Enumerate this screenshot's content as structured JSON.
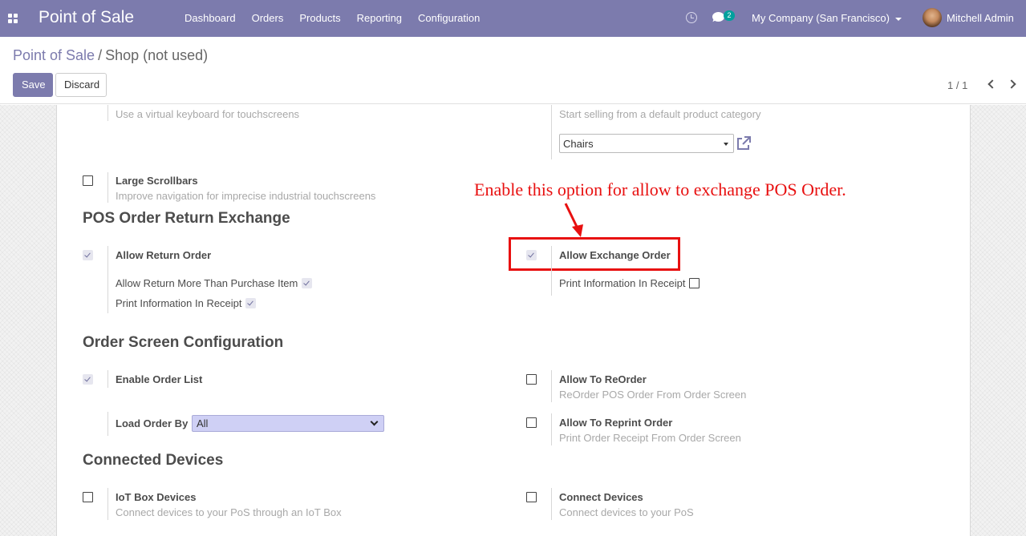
{
  "navbar": {
    "app_title": "Point of Sale",
    "menu": [
      "Dashboard",
      "Orders",
      "Products",
      "Reporting",
      "Configuration"
    ],
    "messages_count": "2",
    "company": "My Company (San Francisco)",
    "user": "Mitchell Admin"
  },
  "breadcrumb": {
    "parent": "Point of Sale",
    "separator": "/",
    "current": "Shop (not used)"
  },
  "toolbar": {
    "save_label": "Save",
    "discard_label": "Discard",
    "pager": "1 / 1"
  },
  "settings": {
    "virtual_keyboard_desc": "Use a virtual keyboard for touchscreens",
    "default_category_desc": "Start selling from a default product category",
    "default_category_value": "Chairs",
    "large_scrollbars": {
      "label": "Large Scrollbars",
      "desc": "Improve navigation for imprecise industrial touchscreens",
      "checked": false
    }
  },
  "return_exchange": {
    "title": "POS Order Return Exchange",
    "allow_return": {
      "label": "Allow Return Order",
      "checked": true
    },
    "return_more": {
      "label": "Allow Return More Than Purchase Item",
      "checked": true
    },
    "return_print": {
      "label": "Print Information In Receipt",
      "checked": true
    },
    "allow_exchange": {
      "label": "Allow Exchange Order",
      "checked": true
    },
    "exchange_print": {
      "label": "Print Information In Receipt",
      "checked": false
    }
  },
  "annotation": {
    "text": "Enable this option for allow to exchange POS Order.",
    "color": "#e81010"
  },
  "order_screen": {
    "title": "Order Screen Configuration",
    "enable_list": {
      "label": "Enable Order List",
      "checked": true
    },
    "load_order_by": {
      "label": "Load Order By",
      "value": "All"
    },
    "reorder": {
      "label": "Allow To ReOrder",
      "desc": "ReOrder POS Order From Order Screen",
      "checked": false
    },
    "reprint": {
      "label": "Allow To Reprint Order",
      "desc": "Print Order Receipt From Order Screen",
      "checked": false
    }
  },
  "devices": {
    "title": "Connected Devices",
    "iot": {
      "label": "IoT Box Devices",
      "desc": "Connect devices to your PoS through an IoT Box",
      "checked": false
    },
    "connect": {
      "label": "Connect Devices",
      "desc": "Connect devices to your PoS",
      "checked": false
    }
  },
  "colors": {
    "brand": "#7c7bad",
    "badge": "#00a09d",
    "annotation": "#e81010"
  }
}
